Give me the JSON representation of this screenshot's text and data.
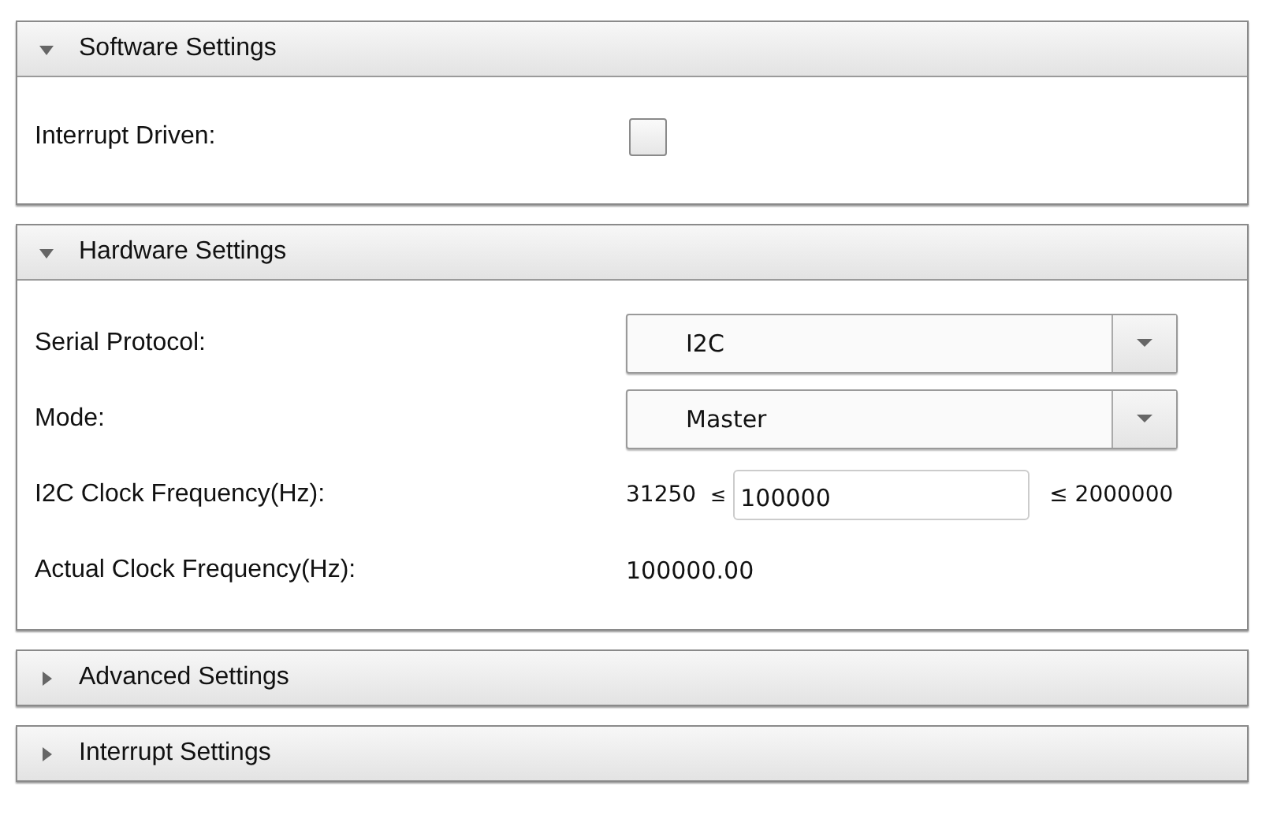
{
  "sections": [
    {
      "title": "Software Settings",
      "expanded": true,
      "rows": [
        {
          "kind": "checkbox",
          "label": "Interrupt Driven:",
          "checked": false
        }
      ]
    },
    {
      "title": "Hardware Settings",
      "expanded": true,
      "rows": [
        {
          "kind": "select",
          "label": "Serial Protocol:",
          "value": "I2C"
        },
        {
          "kind": "select",
          "label": "Mode:",
          "value": "Master"
        },
        {
          "kind": "range",
          "label": "I2C Clock Frequency(Hz):",
          "min": "31250",
          "min_sign": "≤",
          "value": "100000",
          "max": "≤ 2000000"
        },
        {
          "kind": "readout",
          "label": "Actual Clock Frequency(Hz):",
          "value": "100000.00"
        }
      ]
    },
    {
      "title": "Advanced Settings",
      "expanded": false
    },
    {
      "title": "Interrupt Settings",
      "expanded": false
    }
  ]
}
